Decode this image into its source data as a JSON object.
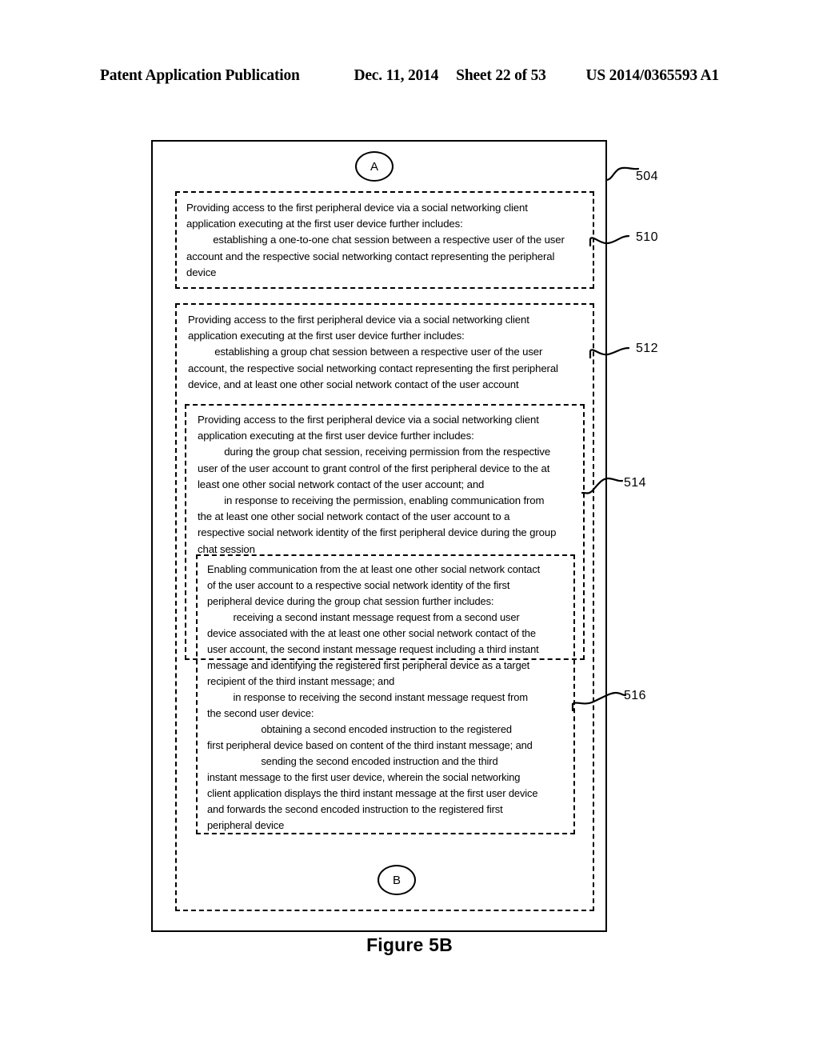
{
  "header": {
    "publication": "Patent Application Publication",
    "date": "Dec. 11, 2014",
    "sheet": "Sheet 22 of 53",
    "patent_number": "US 2014/0365593 A1"
  },
  "figure": {
    "caption": "Figure 5B",
    "connector_in": "A",
    "connector_out": "B"
  },
  "refs": {
    "r504": "504",
    "r510": "510",
    "r512": "512",
    "r514": "514",
    "r516": "516"
  },
  "boxes": {
    "b510": "Providing access to the first peripheral device via a social networking client\napplication executing at the first user device further includes:\n    establishing a one-to-one chat session between a respective user of the user\naccount and the respective social networking contact representing the peripheral\ndevice",
    "b512": "Providing access to the first peripheral device via a social networking client\napplication executing at the first user device further includes:\n    establishing a group chat session between a respective user of the user\naccount, the respective social networking contact representing the first peripheral\ndevice, and at least one other social network contact of the user account",
    "b514": "Providing access to the first peripheral device via a social networking client\napplication executing at the first user device further includes:\n    during the group chat session, receiving permission from the respective\nuser of the user account to grant control of the first peripheral device to the at\nleast one other social network contact of the user account; and\n    in response to receiving the permission, enabling communication from\nthe at least one other social network contact of the user account to a\nrespective social network identity of the first peripheral device during the group\nchat session",
    "b516": "Enabling communication from the at least one other social network contact\nof the user account to a respective social network identity of the first\nperipheral device during the group chat session further includes:\n    receiving a second instant message request from a second user\ndevice associated with the at least one other social network contact of the\nuser account, the second instant message request including a third instant\nmessage and identifying the registered first peripheral device as a target\nrecipient of the third instant message; and\n    in response to receiving the second instant message request from\nthe second user device:\n      obtaining a second encoded instruction to the registered\nfirst peripheral device based on content of the third instant message; and\n      sending the second encoded instruction and the third\ninstant message to the first user device, wherein the social networking\nclient application displays the third instant message at the first user device\nand forwards the second encoded instruction to the registered first\nperipheral device"
  },
  "colors": {
    "ink": "#000000",
    "paper": "#ffffff"
  }
}
